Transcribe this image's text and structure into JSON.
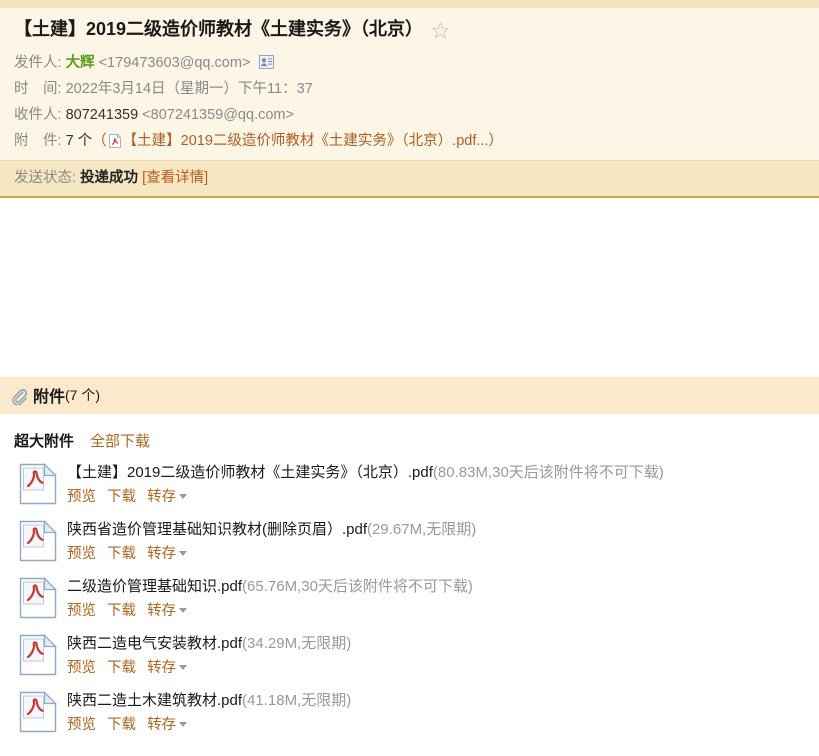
{
  "header": {
    "subject": "【土建】2019二级造价师教材《土建实务》（北京）",
    "star_icon": "star-outline-icon",
    "sender": {
      "label": "发件人:",
      "name": "大辉",
      "email": "<179473603@qq.com>",
      "vcard_icon": "contact-card-icon"
    },
    "time": {
      "label": "时　间:",
      "value": "2022年3月14日（星期一）下午11：37"
    },
    "recipient": {
      "label": "收件人:",
      "name": "807241359",
      "email": "<807241359@qq.com>"
    },
    "attachment_summary": {
      "label": "附　件:",
      "count": "7 个",
      "open_paren": "（",
      "pdf_icon": "pdf-file-icon",
      "first_name": "【土建】2019二级造价师教材《土建实务》（北京）.pdf...",
      "close_paren": "）"
    }
  },
  "status": {
    "label": "发送状态:",
    "value": "投递成功",
    "detail_link": "[查看详情]"
  },
  "attachments_panel": {
    "clip_icon": "paperclip-icon",
    "title": "附件",
    "count_text": "(7 个)",
    "kind_label": "超大附件",
    "download_all_label": "全部下载",
    "items": [
      {
        "icon": "pdf-file-icon",
        "filename": "【土建】2019二级造价师教材《土建实务》（北京）.pdf",
        "meta": "(80.83M,30天后该附件将不可下载)",
        "actions": [
          "预览",
          "下载",
          "转存"
        ],
        "has_caret": true
      },
      {
        "icon": "pdf-file-icon",
        "filename": "陕西省造价管理基础知识教材(删除页眉）.pdf",
        "meta": "(29.67M,无限期)",
        "actions": [
          "预览",
          "下载",
          "转存"
        ],
        "has_caret": true
      },
      {
        "icon": "pdf-file-icon",
        "filename": "二级造价管理基础知识.pdf",
        "meta": "(65.76M,30天后该附件将不可下载)",
        "actions": [
          "预览",
          "下载",
          "转存"
        ],
        "has_caret": true
      },
      {
        "icon": "pdf-file-icon",
        "filename": "陕西二造电气安装教材.pdf",
        "meta": "(34.29M,无限期)",
        "actions": [
          "预览",
          "下载",
          "转存"
        ],
        "has_caret": true
      },
      {
        "icon": "pdf-file-icon",
        "filename": "陕西二造土木建筑教材.pdf",
        "meta": "(41.18M,无限期)",
        "actions": [
          "预览",
          "下载",
          "转存"
        ],
        "has_caret": true
      }
    ]
  },
  "colors": {
    "accent_orange": "#b3651a",
    "header_bg": "#fdf6e6",
    "header_top_band": "#f4e3be",
    "status_bg": "#f6e7c3",
    "attach_band_bg": "#faeacb",
    "border_orange": "#d9a441",
    "sender_green": "#5a9e1a",
    "meta_gray": "#999999"
  }
}
